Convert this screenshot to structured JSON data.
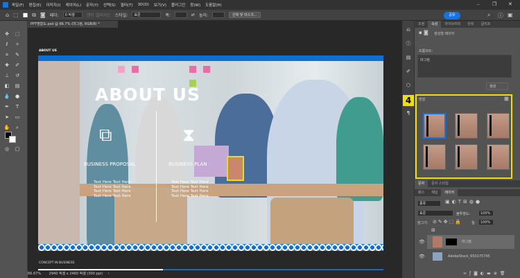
{
  "menu": [
    "파일(F)",
    "편집(E)",
    "이미지(I)",
    "레이어(L)",
    "문자(Y)",
    "선택(S)",
    "필터(T)",
    "3D(D)",
    "보기(V)",
    "플러그인",
    "창(W)",
    "도움말(H)"
  ],
  "options": {
    "feather_label": "페더:",
    "feather_value": "0 픽셀",
    "antialias": "앤티 앨리어스",
    "style_label": "스타일:",
    "style_value": "표준",
    "width_label": "폭:",
    "height_label": "높이:",
    "select_mask": "선택 및 마스크...",
    "share": "공유"
  },
  "document": {
    "tab": "PPT명함도.psd @ 66.7% (마그컴, RGB/8) *",
    "artboard_top": "ABOUT US",
    "artboard_bottom": "CONCEPT IN BUSINESS",
    "zoom": "66.67%",
    "size": "2940 픽셀 x 2460 픽셀 (300 ppi)"
  },
  "slide": {
    "title": "ABOUT US",
    "col1_heading": "BUSINESS PROPOSAL",
    "col2_heading": "BUSINESS PLAN",
    "body_line": "Text Here Text Here"
  },
  "properties": {
    "tabs": [
      "조정",
      "속성",
      "라이브러리",
      "단락",
      "글리프"
    ],
    "active_tab": 1,
    "layer_type": "생성형 레이어",
    "prompt_label": "프롬프트:",
    "prompt_value": "마그컴",
    "generate": "생성",
    "variations_label": "변형",
    "badge": "4"
  },
  "lower_tabs": [
    "문자",
    "문자 스타일"
  ],
  "layers_panel": {
    "tabs": [
      "패스",
      "채널",
      "레이어"
    ],
    "active_tab": 2,
    "filter": "종류",
    "blend": "표준",
    "opacity_label": "불투명도:",
    "opacity": "100%",
    "lock_label": "잠그기:",
    "fill_label": "칠:",
    "fill": "100%",
    "layers": [
      {
        "name": "마그컴"
      },
      {
        "name": "AdobeStock_650175745"
      }
    ]
  },
  "colors": {
    "accent": "#1473e6",
    "highlight": "#f0e000",
    "slide_blue": "#0d6fd1"
  }
}
